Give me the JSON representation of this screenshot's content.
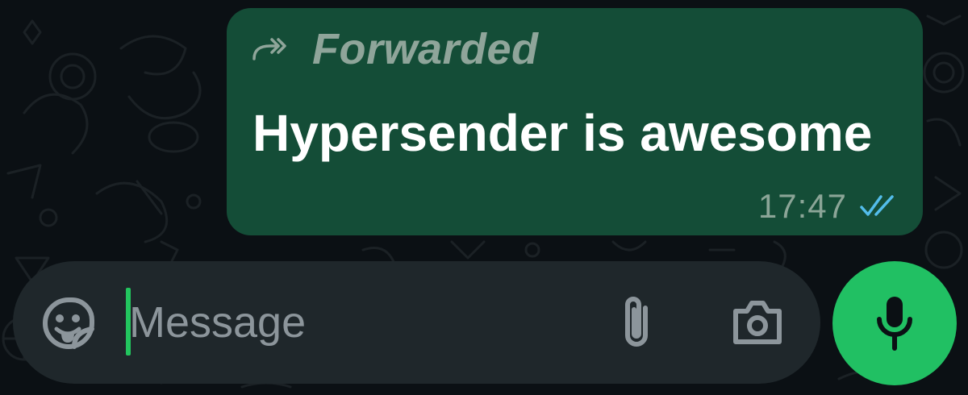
{
  "chat": {
    "message": {
      "forwarded_label": "Forwarded",
      "text": "Hypersender is awesome",
      "time": "17:47",
      "status_icon": "double-check-read-icon",
      "forwarded_icon": "forward-arrow-icon"
    }
  },
  "composer": {
    "placeholder": "Message",
    "value": "",
    "sticker_icon": "sticker-icon",
    "attach_icon": "paperclip-icon",
    "camera_icon": "camera-icon",
    "mic_icon": "microphone-icon"
  },
  "colors": {
    "background": "#0b1014",
    "bubble_outgoing": "#144d37",
    "composer_bg": "#1f272b",
    "accent_green": "#21c063",
    "read_tick": "#53bdeb"
  }
}
